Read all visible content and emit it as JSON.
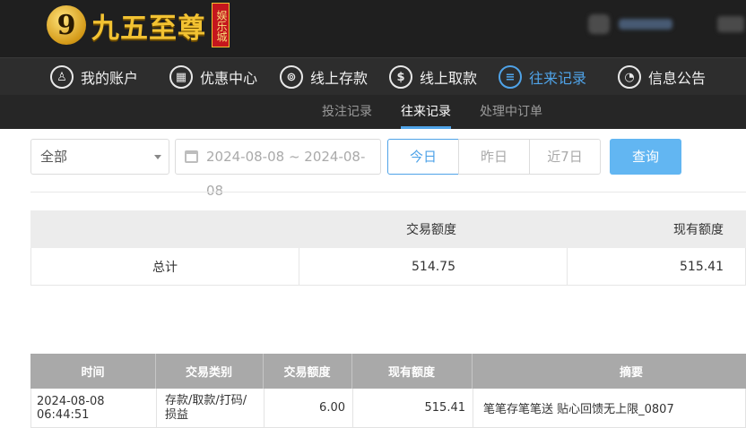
{
  "brand": {
    "logo_mark": "9",
    "name": "九五至尊",
    "seal": "娱乐城"
  },
  "main_nav": [
    {
      "label": "我的账户",
      "icon": "user-icon",
      "glyph": "♙"
    },
    {
      "label": "优惠中心",
      "icon": "gift-icon",
      "glyph": "▦"
    },
    {
      "label": "线上存款",
      "icon": "deposit-icon",
      "glyph": "⊚"
    },
    {
      "label": "线上取款",
      "icon": "withdraw-icon",
      "glyph": "$"
    },
    {
      "label": "往来记录",
      "icon": "records-icon",
      "glyph": "≡",
      "active": true
    },
    {
      "label": "信息公告",
      "icon": "bell-icon",
      "glyph": "◔"
    }
  ],
  "sub_nav": [
    {
      "label": "投注记录"
    },
    {
      "label": "往来记录",
      "active": true
    },
    {
      "label": "处理中订单"
    }
  ],
  "filters": {
    "type_select": "全部",
    "date_range": "2024-08-08 ~ 2024-08-08",
    "quick_today": "今日",
    "quick_yesterday": "昨日",
    "quick_7days": "近7日",
    "query_button": "查询"
  },
  "summary": {
    "headers": [
      "",
      "交易额度",
      "现有额度"
    ],
    "row": {
      "label": "总计",
      "amount": "514.75",
      "balance": "515.41"
    }
  },
  "records": {
    "headers": [
      "时间",
      "交易类别",
      "交易额度",
      "现有额度",
      "摘要"
    ],
    "rows": [
      {
        "time": "2024-08-08 06:44:51",
        "type": "存款/取款/打码/损益",
        "amount": "6.00",
        "balance": "515.41",
        "note": "笔笔存笔笔送 贴心回馈无上限_0807"
      }
    ]
  },
  "colors": {
    "accent": "#4fa3e8",
    "query_button": "#62b6f2",
    "header_bg": "#1f1f1f",
    "nav_bg": "#2d2d2d"
  }
}
